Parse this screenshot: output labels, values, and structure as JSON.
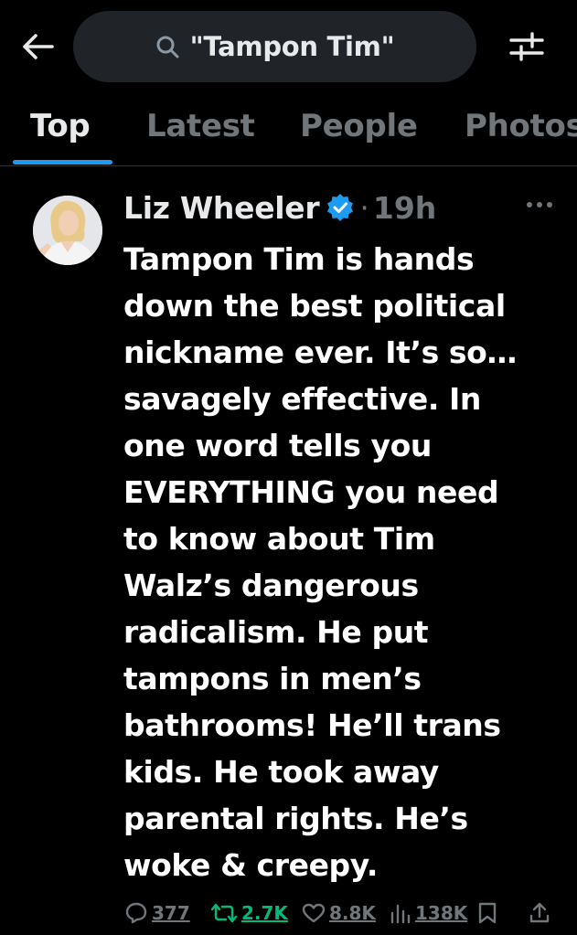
{
  "header": {
    "back_icon": "arrow-left-icon",
    "search_query": "\"Tampon Tim\"",
    "filter_icon": "sliders-icon"
  },
  "tabs": [
    {
      "label": "Top",
      "active": true
    },
    {
      "label": "Latest",
      "active": false
    },
    {
      "label": "People",
      "active": false
    },
    {
      "label": "Photos",
      "active": false
    }
  ],
  "post": {
    "author": "Liz Wheeler",
    "verified": true,
    "separator": "·",
    "time": "19h",
    "lines": [
      "Tampon Tim is hands",
      "down the best political",
      "nickname ever. It’s so…",
      "savagely effective. In",
      "one word tells you",
      "EVERYTHING you need",
      "to know about Tim",
      "Walz’s dangerous",
      "radicalism. He put",
      "tampons in men’s",
      "bathrooms! He’ll trans",
      "kids. He took away",
      "parental rights. He’s",
      "woke & creepy."
    ],
    "stats": {
      "replies": "377",
      "reposts": "2.7K",
      "likes": "8.8K",
      "views": "138K"
    }
  },
  "colors": {
    "accent": "#1d9bf0",
    "repost": "#00ba7c",
    "muted": "#71767b",
    "background": "#000000"
  }
}
